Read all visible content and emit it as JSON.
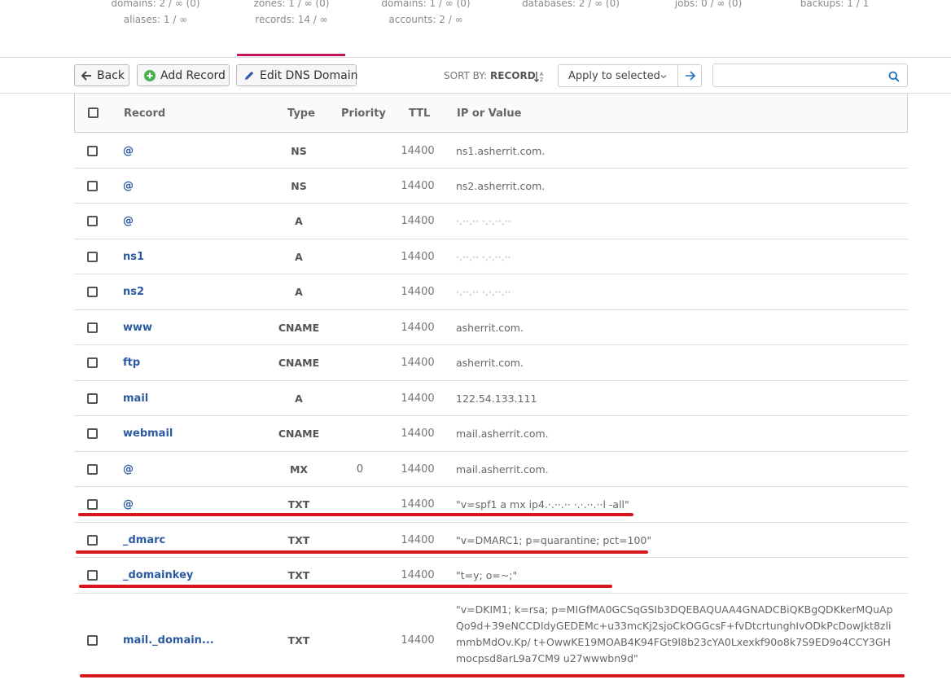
{
  "stats": {
    "columns": [
      {
        "line1": "domains: 2 / ∞ (0)",
        "line2": "aliases: 1 / ∞"
      },
      {
        "line1": "zones: 1 / ∞ (0)",
        "line2": "records: 14 / ∞"
      },
      {
        "line1": "domains: 1 / ∞ (0)",
        "line2": "accounts: 2 / ∞"
      },
      {
        "line1": "databases: 2 / ∞ (0)",
        "line2": ""
      },
      {
        "line1": "jobs: 0 / ∞ (0)",
        "line2": ""
      },
      {
        "line1": "backups: 1 / 1",
        "line2": ""
      }
    ]
  },
  "toolbar": {
    "back_label": "Back",
    "add_record_label": "Add Record",
    "edit_dns_label": "Edit DNS Domain",
    "sort_by_label": "SORT BY:",
    "sort_by_value": "RECORD",
    "apply_selected_label": "Apply to selected",
    "search_placeholder": ""
  },
  "table": {
    "headers": {
      "record": "Record",
      "type": "Type",
      "priority": "Priority",
      "ttl": "TTL",
      "value": "IP or Value"
    },
    "rows": [
      {
        "record": "@",
        "type": "NS",
        "priority": "",
        "ttl": "14400",
        "value": "ns1.asherrit.com."
      },
      {
        "record": "@",
        "type": "NS",
        "priority": "",
        "ttl": "14400",
        "value": "ns2.asherrit.com."
      },
      {
        "record": "@",
        "type": "A",
        "priority": "",
        "ttl": "14400",
        "value": "·.··.··  ·.·.··.··"
      },
      {
        "record": "ns1",
        "type": "A",
        "priority": "",
        "ttl": "14400",
        "value": "·.··.··  ·.·.··.··"
      },
      {
        "record": "ns2",
        "type": "A",
        "priority": "",
        "ttl": "14400",
        "value": "·.··.··  ·.·.··.··"
      },
      {
        "record": "www",
        "type": "CNAME",
        "priority": "",
        "ttl": "14400",
        "value": "asherrit.com."
      },
      {
        "record": "ftp",
        "type": "CNAME",
        "priority": "",
        "ttl": "14400",
        "value": "asherrit.com."
      },
      {
        "record": "mail",
        "type": "A",
        "priority": "",
        "ttl": "14400",
        "value": "122.54.133.111"
      },
      {
        "record": "webmail",
        "type": "CNAME",
        "priority": "",
        "ttl": "14400",
        "value": "mail.asherrit.com."
      },
      {
        "record": "@",
        "type": "MX",
        "priority": "0",
        "ttl": "14400",
        "value": "mail.asherrit.com."
      },
      {
        "record": "@",
        "type": "TXT",
        "priority": "",
        "ttl": "14400",
        "value": "\"v=spf1 a mx ip4.·.··.·· ·.·.··.··l -all\""
      },
      {
        "record": "_dmarc",
        "type": "TXT",
        "priority": "",
        "ttl": "14400",
        "value": "\"v=DMARC1; p=quarantine; pct=100\""
      },
      {
        "record": "_domainkey",
        "type": "TXT",
        "priority": "",
        "ttl": "14400",
        "value": "\"t=y; o=~;\""
      },
      {
        "record": "mail._domain...",
        "type": "TXT",
        "priority": "",
        "ttl": "14400",
        "value": "\"v=DKIM1; k=rsa; p=MIGfMA0GCSqGSIb3DQEBAQUAA4GNADCBiQKBgQDKkerMQuApQo9d+39eNCCDIdyGEDEMc+u33mcKj2sjoCkOGGcsF+fvDtcrtunghIvODkPcDowJkt8zlimmbMdOv.Kp/ t+OwwKE19MOAB4K94FGt9l8b23cYA0Lxexkf90o8k7S9ED9o4CCY3GHmocpsd8arL9a7CM9 u27wwwbn9d\""
      }
    ]
  },
  "colors": {
    "accent_tab": "#c2185b",
    "link": "#2c5aa0",
    "annotation_line": "#d7171f",
    "search_icon": "#1e6fb8",
    "add_icon": "#4caf50"
  }
}
